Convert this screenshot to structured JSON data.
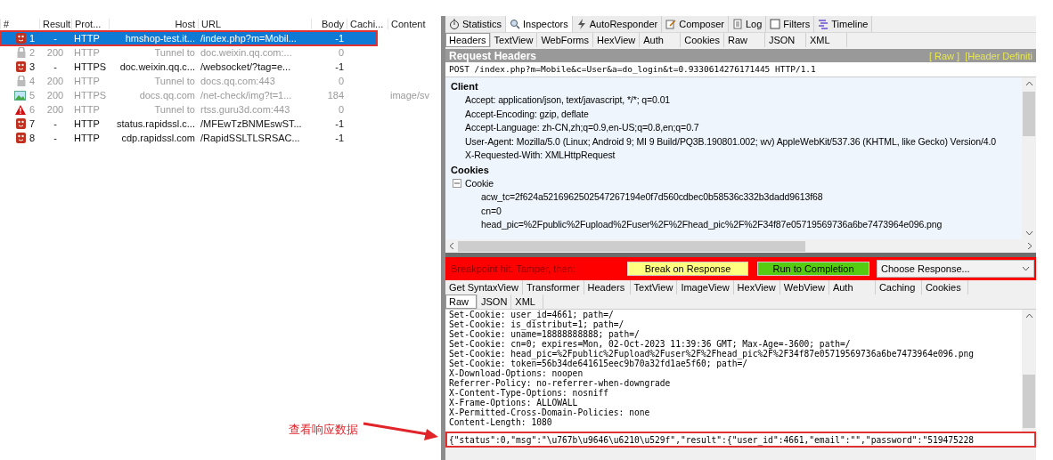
{
  "sessions": {
    "columns": [
      "#",
      "Result",
      "Prot...",
      "Host",
      "URL",
      "Body",
      "Cachi...",
      "Content"
    ],
    "rows": [
      {
        "number": "1",
        "result": "-",
        "protocol": "HTTP",
        "host": "hmshop-test.it...",
        "url": "/index.php?m=Mobil...",
        "body": "-1",
        "kind": "breakpoint",
        "dimmed": false,
        "selected": true,
        "annotated": true
      },
      {
        "number": "2",
        "result": "200",
        "protocol": "HTTP",
        "host": "Tunnel to",
        "url": "doc.weixin.qq.com:...",
        "body": "0",
        "kind": "lock",
        "dimmed": true,
        "selected": false,
        "annotated": false
      },
      {
        "number": "3",
        "result": "-",
        "protocol": "HTTPS",
        "host": "doc.weixin.qq.c...",
        "url": "/websocket/?tag=e...",
        "body": "-1",
        "kind": "breakpoint",
        "dimmed": false,
        "selected": false,
        "annotated": false
      },
      {
        "number": "4",
        "result": "200",
        "protocol": "HTTP",
        "host": "Tunnel to",
        "url": "docs.qq.com:443",
        "body": "0",
        "kind": "lock",
        "dimmed": true,
        "selected": false,
        "annotated": false
      },
      {
        "number": "5",
        "result": "200",
        "protocol": "HTTPS",
        "host": "docs.qq.com",
        "url": "/net-check/img?t=1...",
        "body": "184",
        "content": "image/sv",
        "kind": "image",
        "dimmed": true,
        "selected": false,
        "annotated": false
      },
      {
        "number": "6",
        "result": "200",
        "protocol": "HTTP",
        "host": "Tunnel to",
        "url": "rtss.guru3d.com:443",
        "body": "0",
        "kind": "warning",
        "dimmed": true,
        "selected": false,
        "annotated": false
      },
      {
        "number": "7",
        "result": "-",
        "protocol": "HTTP",
        "host": "status.rapidssl.c...",
        "url": "/MFEwTzBNMEswST...",
        "body": "-1",
        "kind": "breakpoint",
        "dimmed": false,
        "selected": false,
        "annotated": false
      },
      {
        "number": "8",
        "result": "-",
        "protocol": "HTTP",
        "host": "cdp.rapidssl.com",
        "url": "/RapidSSLTLSRSAC...",
        "body": "-1",
        "kind": "breakpoint",
        "dimmed": false,
        "selected": false,
        "annotated": false
      }
    ]
  },
  "annotation": {
    "text": "查看响应数据"
  },
  "inspector": {
    "tabs": [
      {
        "label": "Statistics",
        "kind": "stopwatch",
        "selected": false
      },
      {
        "label": "Inspectors",
        "kind": "inspect",
        "selected": true
      },
      {
        "label": "AutoResponder",
        "kind": "bolt",
        "selected": false
      },
      {
        "label": "Composer",
        "kind": "edit",
        "selected": false
      },
      {
        "label": "Log",
        "kind": "doc",
        "selected": false
      },
      {
        "label": "Filters",
        "kind": "checkbox",
        "selected": false
      },
      {
        "label": "Timeline",
        "kind": "timeline",
        "selected": false
      }
    ],
    "request_tabs": [
      {
        "label": "Headers",
        "selected": true
      },
      {
        "label": "TextView",
        "selected": false
      },
      {
        "label": "WebForms",
        "selected": false
      },
      {
        "label": "HexView",
        "selected": false
      },
      {
        "label": "Auth",
        "selected": false
      },
      {
        "label": "Cookies",
        "selected": false
      },
      {
        "label": "Raw",
        "selected": false
      },
      {
        "label": "JSON",
        "selected": false
      },
      {
        "label": "XML",
        "selected": false
      }
    ],
    "request_headers": {
      "title": "Request Headers",
      "links": [
        "[ Raw ]",
        "[Header Definiti"
      ],
      "request_line": "POST /index.php?m=Mobile&c=User&a=do_login&t=0.9330614276171445 HTTP/1.1",
      "groups": [
        {
          "title": "Client",
          "items": [
            {
              "text": "Accept: application/json, text/javascript, */*; q=0.01"
            },
            {
              "text": "Accept-Encoding: gzip, deflate"
            },
            {
              "text": "Accept-Language: zh-CN,zh;q=0.9,en-US;q=0.8,en;q=0.7"
            },
            {
              "text": "User-Agent: Mozilla/5.0 (Linux; Android 9; MI 9 Build/PQ3B.190801.002; wv) AppleWebKit/537.36 (KHTML, like Gecko) Version/4.0"
            },
            {
              "text": "X-Requested-With: XMLHttpRequest"
            }
          ]
        },
        {
          "title": "Cookies",
          "items": [
            {
              "text": "Cookie",
              "expanded": true,
              "children": [
                {
                  "text": "acw_tc=2f624a5216962502547267194e0f7d560cdbec0b58536c332b3dadd9613f68"
                },
                {
                  "text": "cn=0"
                },
                {
                  "text": "head_pic=%2Fpublic%2Fupload%2Fuser%2F%2Fhead_pic%2F%2F34f87e05719569736a6be7473964e096.png"
                }
              ]
            }
          ]
        }
      ]
    }
  },
  "breakpoint": {
    "label": "Breakpoint hit. Tamper, then:",
    "break_button": "Break on Response",
    "run_button": "Run to Completion",
    "response_select": "Choose Response..."
  },
  "response_tabs": [
    {
      "label": "Get SyntaxView",
      "selected": false
    },
    {
      "label": "Transformer",
      "selected": false
    },
    {
      "label": "Headers",
      "selected": false
    },
    {
      "label": "TextView",
      "selected": false
    },
    {
      "label": "ImageView",
      "selected": false
    },
    {
      "label": "HexView",
      "selected": false
    },
    {
      "label": "WebView",
      "selected": false
    },
    {
      "label": "Auth",
      "selected": false
    },
    {
      "label": "Caching",
      "selected": false
    },
    {
      "label": "Cookies",
      "selected": false
    }
  ],
  "response_subtabs": [
    {
      "label": "Raw",
      "selected": true
    },
    {
      "label": "JSON",
      "selected": false
    },
    {
      "label": "XML",
      "selected": false
    }
  ],
  "response_lines": [
    "Set-Cookie: user_id=4661; path=/",
    "Set-Cookie: is_distribut=1; path=/",
    "Set-Cookie: uname=18888888888; path=/",
    "Set-Cookie: cn=0; expires=Mon, 02-Oct-2023 11:39:36 GMT; Max-Age=-3600; path=/",
    "Set-Cookie: head_pic=%2Fpublic%2Fupload%2Fuser%2F%2Fhead_pic%2F%2F34f87e05719569736a6be7473964e096.png",
    "Set-Cookie: token=56b34de641615eec9b70a32fd1ae5f60; path=/",
    "X-Download-Options: noopen",
    "Referrer-Policy: no-referrer-when-downgrade",
    "X-Content-Type-Options: nosniff",
    "X-Frame-Options: ALLOWALL",
    "X-Permitted-Cross-Domain-Policies: none",
    "Content-Length: 1080"
  ],
  "response_body": "{\"status\":0,\"msg\":\"\\u767b\\u9646\\u6210\\u529f\",\"result\":{\"user_id\":4661,\"email\":\"\",\"password\":\"519475228"
}
